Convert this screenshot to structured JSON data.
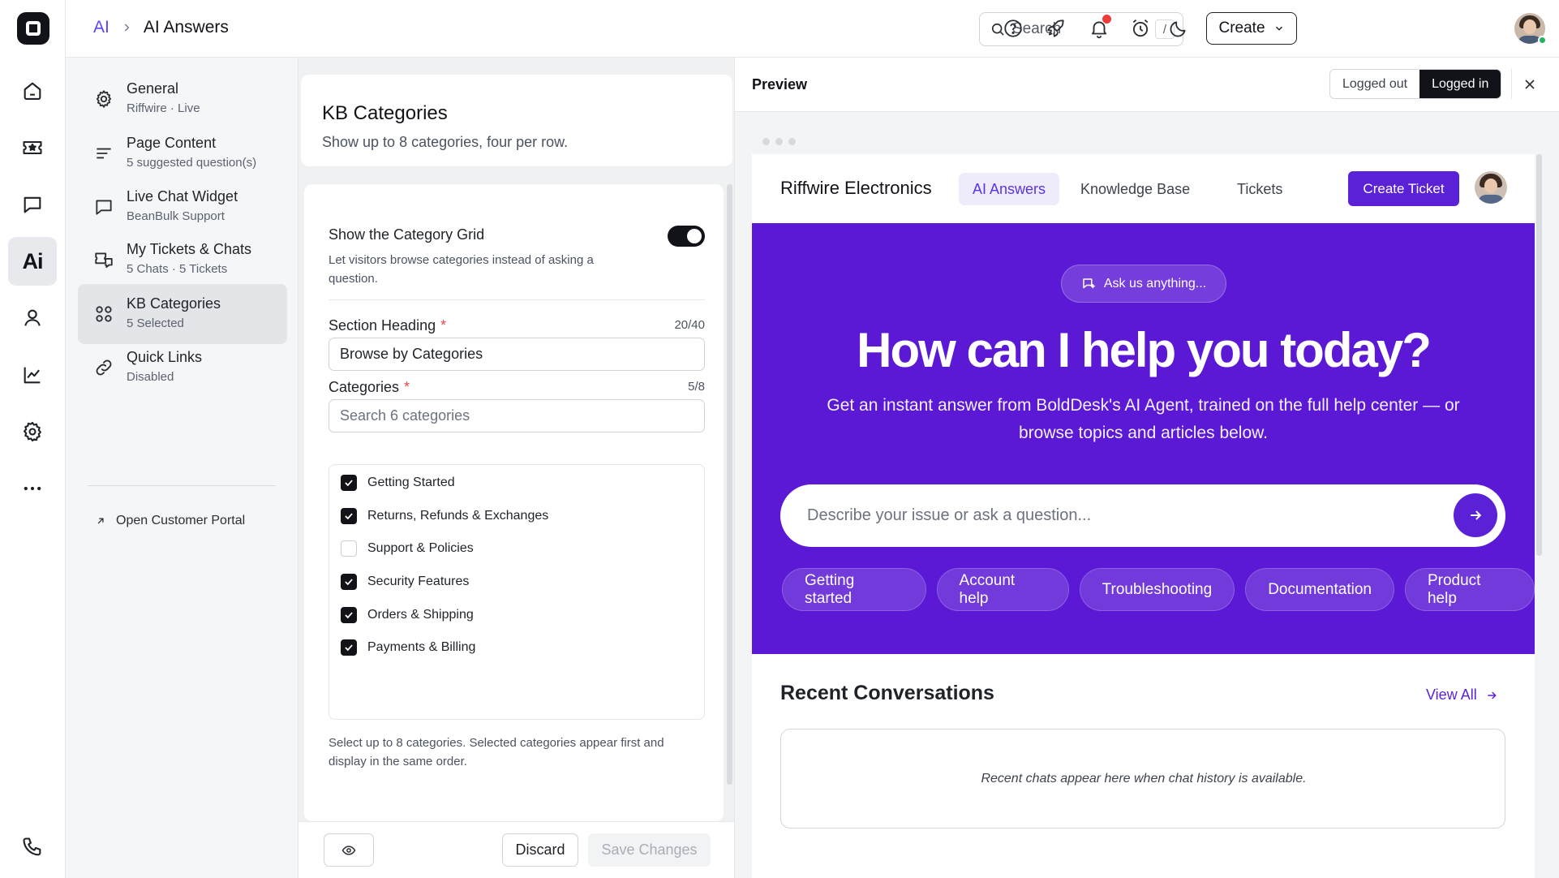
{
  "breadcrumb": {
    "parent": "AI",
    "current": "AI Answers"
  },
  "topbar": {
    "search_placeholder": "Search",
    "search_shortcut": "/",
    "create_label": "Create"
  },
  "rail": {
    "ai_label": "Ai"
  },
  "settings_nav": {
    "items": [
      {
        "title": "General",
        "subtitle": "Riffwire · Live",
        "icon": "gear-icon"
      },
      {
        "title": "Page Content",
        "subtitle": "5 suggested question(s)",
        "icon": "text-lines-icon"
      },
      {
        "title": "Live Chat Widget",
        "subtitle": "BeanBulk Support",
        "icon": "chat-bubble-icon"
      },
      {
        "title": "My Tickets & Chats",
        "subtitle": "5 Chats · 5 Tickets",
        "icon": "tickets-chats-icon"
      },
      {
        "title": "KB Categories",
        "subtitle": "5 Selected",
        "icon": "grid-icon"
      },
      {
        "title": "Quick Links",
        "subtitle": "Disabled",
        "icon": "link-icon"
      }
    ],
    "portal_link": "Open Customer Portal"
  },
  "config": {
    "title": "KB Categories",
    "subtitle": "Show up to 8 categories, four per row.",
    "toggle_title": "Show the Category Grid",
    "toggle_desc": "Let visitors browse categories instead of asking a question.",
    "toggle_on": true,
    "heading_label": "Section Heading",
    "heading_count": "20/40",
    "heading_value": "Browse by Categories",
    "categories_label": "Categories",
    "categories_count": "5/8",
    "search_placeholder": "Search 6 categories",
    "categories": [
      {
        "name": "Getting Started",
        "checked": true
      },
      {
        "name": "Returns, Refunds & Exchanges",
        "checked": true
      },
      {
        "name": "Support & Policies",
        "checked": false
      },
      {
        "name": "Security Features",
        "checked": true
      },
      {
        "name": "Orders & Shipping",
        "checked": true
      },
      {
        "name": "Payments & Billing",
        "checked": true
      }
    ],
    "help": "Select up to 8 categories. Selected categories appear first and display in the same order.",
    "discard_label": "Discard",
    "save_label": "Save Changes"
  },
  "preview": {
    "title": "Preview",
    "mode_logged_out": "Logged out",
    "mode_logged_in": "Logged in",
    "active_mode": "Logged in",
    "portal": {
      "brand": "Riffwire Electronics",
      "tabs": [
        "AI Answers",
        "Knowledge Base",
        "Tickets"
      ],
      "create_ticket": "Create Ticket",
      "ask_pill": "Ask us anything...",
      "hero_title": "How can I help you today?",
      "hero_subtitle": "Get an instant answer from BoldDesk's AI Agent, trained on the full help center — or browse topics and articles below.",
      "ask_placeholder": "Describe your issue or ask a question...",
      "chips": [
        "Getting started",
        "Account help",
        "Troubleshooting",
        "Documentation",
        "Product help"
      ],
      "recent_title": "Recent Conversations",
      "view_all": "View All",
      "recent_empty": "Recent chats appear here when chat history is available."
    }
  },
  "colors": {
    "brand_purple": "#5b19d5",
    "accent": "#5b21d6",
    "link": "#5b46f5",
    "notification": "#ef3b3b"
  }
}
